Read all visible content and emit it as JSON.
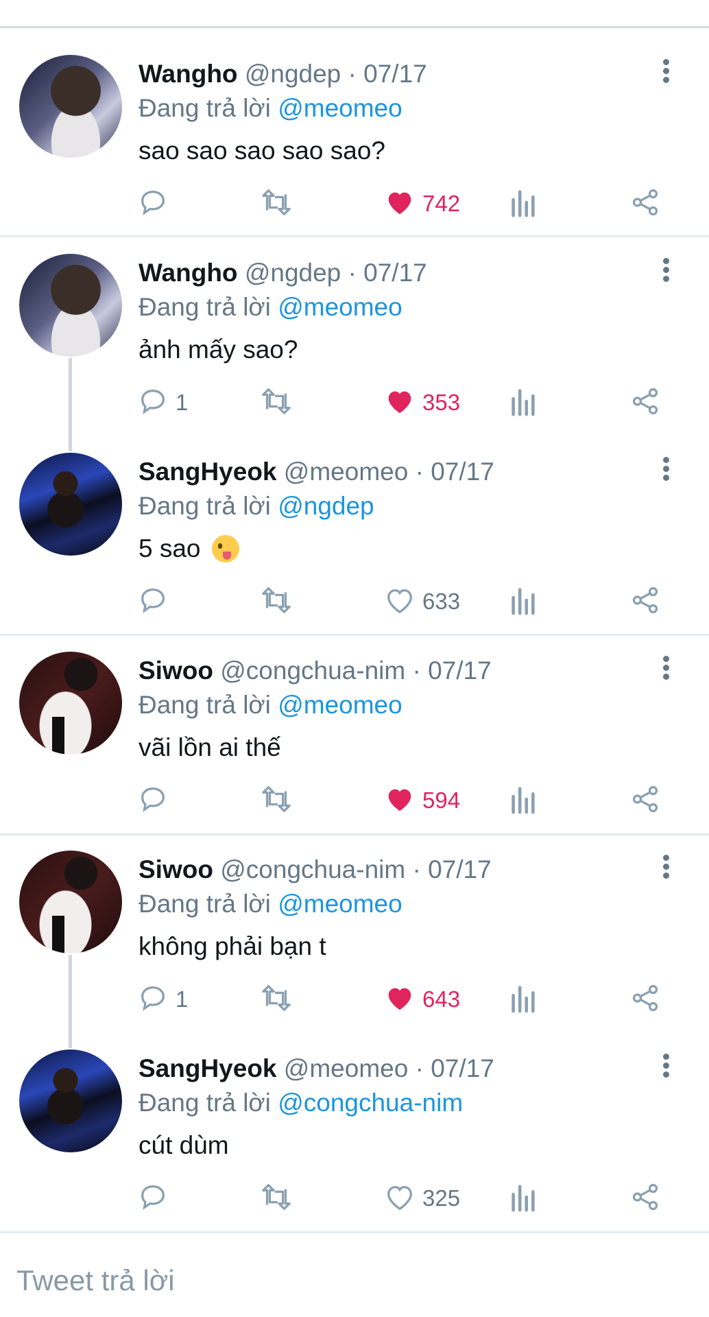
{
  "replying_prefix": "Đang trả lời",
  "tweets": [
    {
      "name": "Wangho",
      "handle": "@ngdep",
      "sep": "·",
      "date": "07/17",
      "reply_to": "@meomeo",
      "text": "sao sao sao sao sao?",
      "replies": "",
      "likes": "742",
      "liked": true,
      "avatar": "avatar-wangho"
    },
    {
      "name": "Wangho",
      "handle": "@ngdep",
      "sep": "·",
      "date": "07/17",
      "reply_to": "@meomeo",
      "text": "ảnh mấy sao?",
      "replies": "1",
      "likes": "353",
      "liked": true,
      "avatar": "avatar-wangho"
    },
    {
      "name": "SangHyeok",
      "handle": "@meomeo",
      "sep": "·",
      "date": "07/17",
      "reply_to": "@ngdep",
      "text": "5 sao",
      "emoji": "winking-tongue-emoji",
      "replies": "",
      "likes": "633",
      "liked": false,
      "avatar": "avatar-sanghyeok"
    },
    {
      "name": "Siwoo",
      "handle": "@congchua-nim",
      "sep": "·",
      "date": "07/17",
      "reply_to": "@meomeo",
      "text": "vãi lồn ai thế",
      "replies": "",
      "likes": "594",
      "liked": true,
      "avatar": "avatar-siwoo"
    },
    {
      "name": "Siwoo",
      "handle": "@congchua-nim",
      "sep": "·",
      "date": "07/17",
      "reply_to": "@meomeo",
      "text": "không phải bạn t",
      "replies": "1",
      "likes": "643",
      "liked": true,
      "avatar": "avatar-siwoo"
    },
    {
      "name": "SangHyeok",
      "handle": "@meomeo",
      "sep": "·",
      "date": "07/17",
      "reply_to": "@congchua-nim",
      "text": "cút dùm",
      "replies": "",
      "likes": "325",
      "liked": false,
      "avatar": "avatar-sanghyeok"
    }
  ],
  "reply_placeholder": "Tweet trả lời",
  "colors": {
    "like": "#e0245e",
    "mention": "#1b95e0",
    "muted": "#657786",
    "icon": "#8aa0b1"
  }
}
